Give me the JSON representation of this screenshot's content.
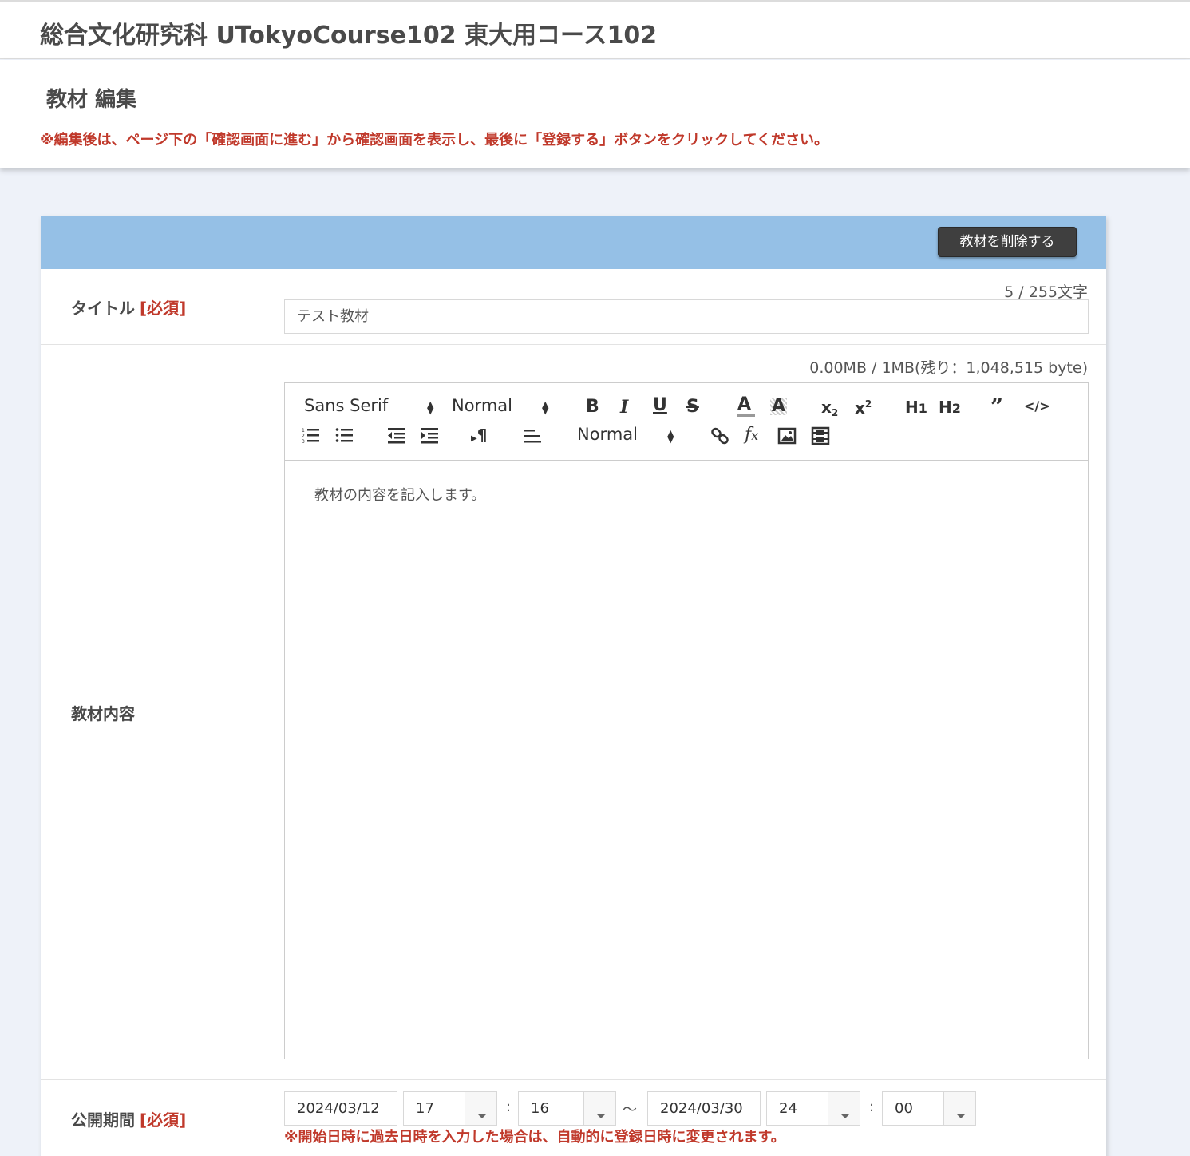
{
  "header": {
    "title": "総合文化研究科 UTokyoCourse102 東大用コース102"
  },
  "subhead": {
    "title": "教材 編集",
    "notice": "※編集後は、ページ下の「確認画面に進む」から確認画面を表示し、最後に「登録する」ボタンをクリックしてください。"
  },
  "panel": {
    "delete_label": "教材を削除する"
  },
  "title_field": {
    "label": "タイトル",
    "required": "[必須]",
    "counter": "5 / 255文字",
    "value": "テスト教材"
  },
  "content_field": {
    "label": "教材内容",
    "counter": "0.00MB / 1MB(残り：1,048,515 byte)",
    "font_select": "Sans Serif",
    "size_select": "Normal",
    "header_select": "Normal",
    "body_text": "教材の内容を記入します。",
    "toolbar_icons": [
      "bold-icon",
      "italic-icon",
      "underline-icon",
      "strike-icon",
      "text-color-icon",
      "background-color-icon",
      "subscript-icon",
      "superscript-icon",
      "h1-icon",
      "h2-icon",
      "blockquote-icon",
      "code-block-icon",
      "ordered-list-icon",
      "bullet-list-icon",
      "outdent-icon",
      "indent-icon",
      "text-direction-icon",
      "align-icon",
      "link-icon",
      "formula-icon",
      "image-icon",
      "video-icon"
    ]
  },
  "period_field": {
    "label": "公開期間",
    "required": "[必須]",
    "start_date": "2024/03/12",
    "start_hour": "17",
    "start_minute": "16",
    "tilde": "〜",
    "colon": ":",
    "end_date": "2024/03/30",
    "end_hour": "24",
    "end_minute": "00",
    "note": "※開始日時に過去日時を入力した場合は、自動的に登録日時に変更されます。"
  }
}
